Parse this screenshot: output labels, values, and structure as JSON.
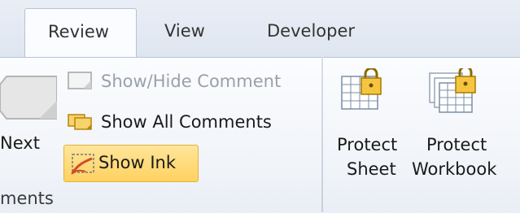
{
  "tabs": {
    "review": "Review",
    "view": "View",
    "developer": "Developer"
  },
  "comments_group": {
    "next_label": "Next",
    "show_hide_comment": "Show/Hide Comment",
    "show_all_comments": "Show All Comments",
    "show_ink": "Show Ink",
    "group_label": "ments"
  },
  "changes_group": {
    "protect_sheet_line1": "Protect",
    "protect_sheet_line2": "Sheet",
    "protect_workbook_line1": "Protect",
    "protect_workbook_line2": "Workbook"
  },
  "colors": {
    "selected_button_fill": "#ffd260",
    "disabled_text": "#9aa1aa"
  }
}
